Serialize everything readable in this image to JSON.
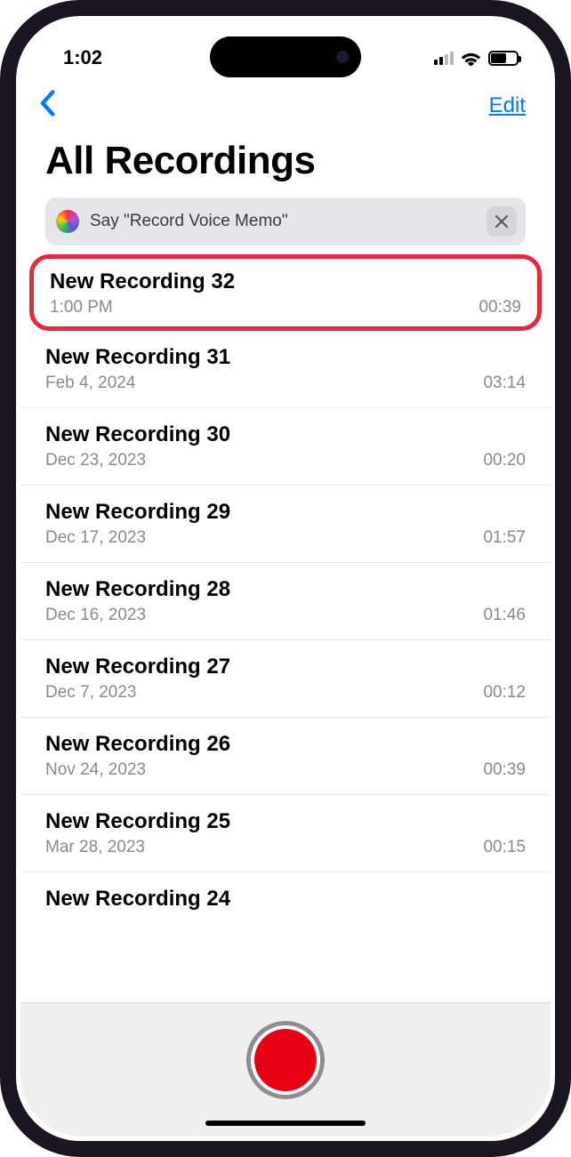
{
  "status": {
    "time": "1:02"
  },
  "nav": {
    "edit_label": "Edit"
  },
  "page": {
    "title": "All Recordings"
  },
  "siri": {
    "hint": "Say \"Record Voice Memo\""
  },
  "recordings": [
    {
      "title": "New Recording 32",
      "date": "1:00 PM",
      "duration": "00:39",
      "highlighted": true
    },
    {
      "title": "New Recording 31",
      "date": "Feb 4, 2024",
      "duration": "03:14"
    },
    {
      "title": "New Recording 30",
      "date": "Dec 23, 2023",
      "duration": "00:20"
    },
    {
      "title": "New Recording 29",
      "date": "Dec 17, 2023",
      "duration": "01:57"
    },
    {
      "title": "New Recording 28",
      "date": "Dec 16, 2023",
      "duration": "01:46"
    },
    {
      "title": "New Recording 27",
      "date": "Dec 7, 2023",
      "duration": "00:12"
    },
    {
      "title": "New Recording 26",
      "date": "Nov 24, 2023",
      "duration": "00:39"
    },
    {
      "title": "New Recording 25",
      "date": "Mar 28, 2023",
      "duration": "00:15"
    },
    {
      "title": "New Recording 24",
      "date": "",
      "duration": ""
    }
  ]
}
